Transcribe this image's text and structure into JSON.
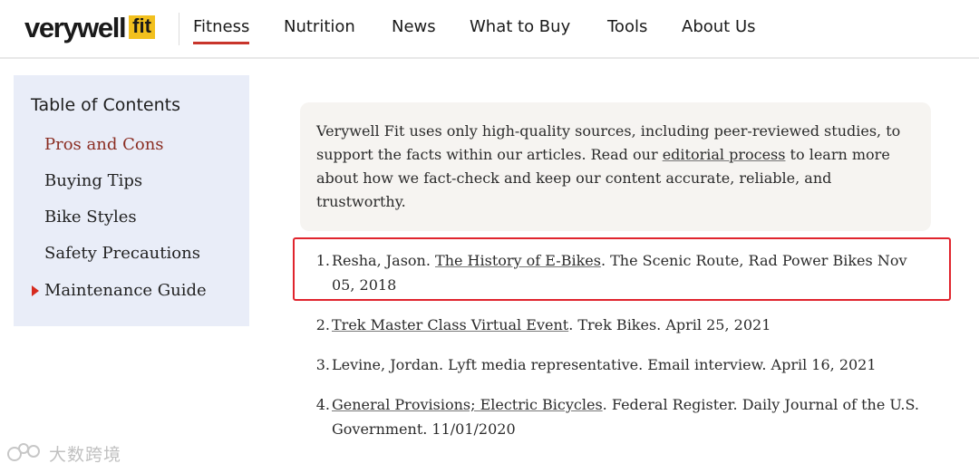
{
  "header": {
    "logo_word": "verywell",
    "logo_badge": "fit",
    "nav": [
      {
        "label": "Fitness",
        "active": true
      },
      {
        "label": "Nutrition"
      },
      {
        "label": "News"
      },
      {
        "label": "What to Buy"
      },
      {
        "label": "Tools"
      },
      {
        "label": "About Us"
      }
    ]
  },
  "toc": {
    "title": "Table of Contents",
    "items": [
      {
        "label": "Pros and Cons"
      },
      {
        "label": "Buying Tips"
      },
      {
        "label": "Bike Styles"
      },
      {
        "label": "Safety Precautions"
      },
      {
        "label": "Maintenance Guide"
      }
    ],
    "current_index": 0,
    "arrow_index": 4
  },
  "info": {
    "text_before": "Verywell Fit uses only high-quality sources, including peer-reviewed studies, to support the facts within our articles. Read our ",
    "link": "editorial process",
    "text_after": " to learn more about how we fact-check and keep our content accurate, reliable, and trustworthy."
  },
  "references": [
    {
      "num": "1.",
      "before": "Resha, Jason. ",
      "link": "The History of E-Bikes",
      "after": ". The Scenic Route, Rad Power Bikes Nov 05, 2018"
    },
    {
      "num": "2.",
      "before": "",
      "link": "Trek Master Class Virtual Event",
      "after": ". Trek Bikes. April 25, 2021"
    },
    {
      "num": "3.",
      "before": "Levine, Jordan. Lyft media representative. Email interview. April 16, 2021",
      "link": "",
      "after": ""
    },
    {
      "num": "4.",
      "before": "",
      "link": "General Provisions; Electric Bicycles",
      "after": ". Federal Register. Daily Journal of the U.S. Government. 11/01/2020"
    }
  ],
  "watermark": {
    "text": "大数跨境"
  },
  "colors": {
    "accent": "#c8352b",
    "toc_bg": "#e9edf8",
    "badge": "#f2c01e",
    "highlight": "#e0242d"
  }
}
